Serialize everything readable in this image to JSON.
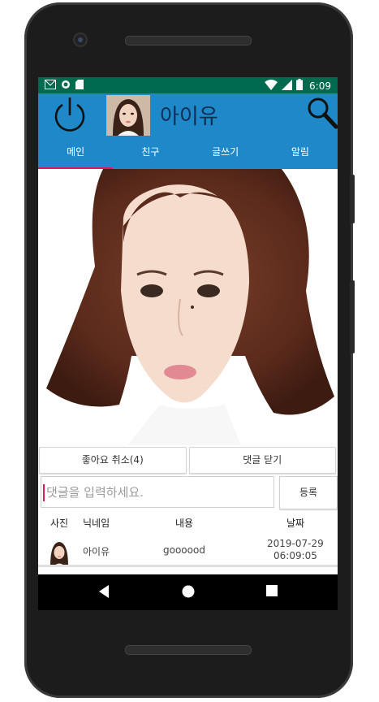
{
  "status_bar": {
    "time": "6:09",
    "icons": [
      "gmail-icon",
      "sync-icon",
      "sdcard-icon",
      "wifi-icon",
      "signal-icon",
      "battery-icon"
    ]
  },
  "app_bar": {
    "title": "아이유",
    "left_icon": "power-icon",
    "right_icon": "search-icon",
    "color": "#1e88c8"
  },
  "tabs": [
    {
      "label": "메인",
      "active": true
    },
    {
      "label": "친구",
      "active": false
    },
    {
      "label": "글쓰기",
      "active": false
    },
    {
      "label": "알림",
      "active": false
    }
  ],
  "post": {
    "like_button": "좋아요 취소(4)",
    "close_comments_button": "댓글 닫기"
  },
  "comment_form": {
    "placeholder": "댓글을 입력하세요.",
    "submit_label": "등록"
  },
  "comments_table": {
    "headers": {
      "photo": "사진",
      "nickname": "닉네임",
      "content": "내용",
      "date": "날짜"
    },
    "rows": [
      {
        "nickname": "아이유",
        "content": "goooood",
        "date": "2019-07-29",
        "time": "06:09:05"
      }
    ]
  },
  "colors": {
    "accent": "#d81b60",
    "status": "#006a4e",
    "primary": "#1e88c8"
  }
}
